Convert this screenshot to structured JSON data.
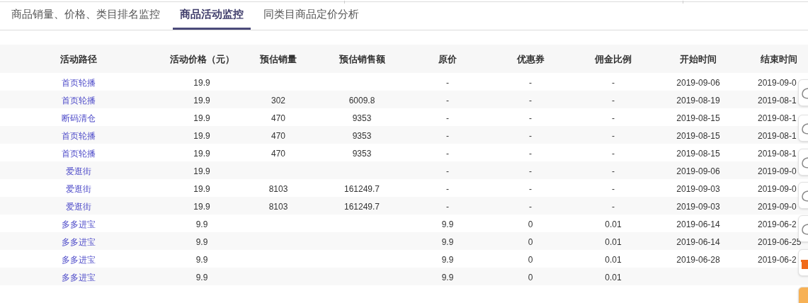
{
  "tabs": [
    {
      "label": "商品销量、价格、类目排名监控",
      "selected": false
    },
    {
      "label": "商品活动监控",
      "selected": true
    },
    {
      "label": "同类目商品定价分析",
      "selected": false
    }
  ],
  "table": {
    "columns": [
      "活动路径",
      "活动价格（元）",
      "预估销量",
      "预估销售额",
      "原价",
      "优惠券",
      "佣金比例",
      "开始时间",
      "结束时间"
    ],
    "rows": [
      [
        "首页轮播",
        "19.9",
        "",
        "",
        "-",
        "-",
        "-",
        "2019-09-06",
        "2019-09-0"
      ],
      [
        "首页轮播",
        "19.9",
        "302",
        "6009.8",
        "-",
        "-",
        "-",
        "2019-08-19",
        "2019-08-1"
      ],
      [
        "断码清仓",
        "19.9",
        "470",
        "9353",
        "-",
        "-",
        "-",
        "2019-08-15",
        "2019-08-1"
      ],
      [
        "首页轮播",
        "19.9",
        "470",
        "9353",
        "-",
        "-",
        "-",
        "2019-08-15",
        "2019-08-1"
      ],
      [
        "首页轮播",
        "19.9",
        "470",
        "9353",
        "-",
        "-",
        "-",
        "2019-08-15",
        "2019-08-1"
      ],
      [
        "爱逛街",
        "19.9",
        "",
        "",
        "-",
        "-",
        "-",
        "2019-09-06",
        "2019-09-0"
      ],
      [
        "爱逛街",
        "19.9",
        "8103",
        "161249.7",
        "-",
        "-",
        "-",
        "2019-09-03",
        "2019-09-0"
      ],
      [
        "爱逛街",
        "19.9",
        "8103",
        "161249.7",
        "-",
        "-",
        "-",
        "2019-09-03",
        "2019-09-0"
      ],
      [
        "多多进宝",
        "9.9",
        "",
        "",
        "9.9",
        "0",
        "0.01",
        "2019-06-14",
        "2019-06-2"
      ],
      [
        "多多进宝",
        "9.9",
        "",
        "",
        "9.9",
        "0",
        "0.01",
        "2019-06-14",
        "2019-06-25"
      ],
      [
        "多多进宝",
        "9.9",
        "",
        "",
        "9.9",
        "0",
        "0.01",
        "2019-06-28",
        "2019-06-2"
      ],
      [
        "多多进宝",
        "9.9",
        "",
        "",
        "9.9",
        "0",
        "0.01",
        "",
        ""
      ]
    ]
  }
}
